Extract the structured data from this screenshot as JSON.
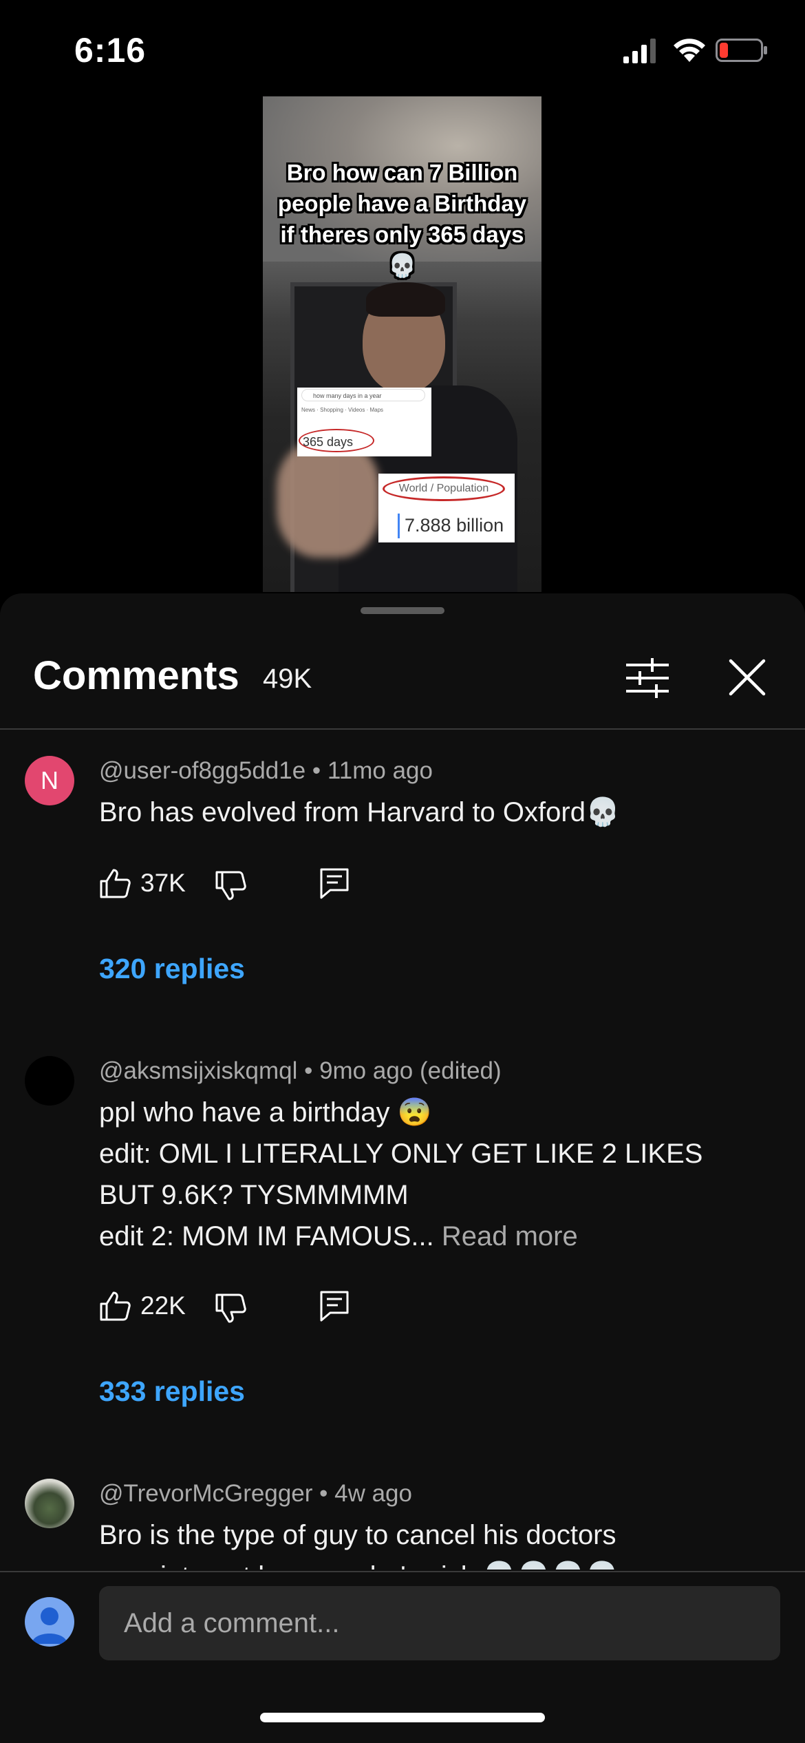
{
  "status_bar": {
    "time": "6:16",
    "icons": [
      "cellular-signal-icon",
      "wifi-icon",
      "battery-low-icon"
    ],
    "battery_color": "#ff3b30"
  },
  "video": {
    "caption": "Bro how can 7 Billion people have a Birthday if theres only 365 days 💀",
    "search_card": {
      "query": "how many days in a year",
      "tabs": "News · Shopping · Videos · Maps",
      "answer": "365 days"
    },
    "population_card": {
      "label": "World / Population",
      "value": "7.888 billion"
    }
  },
  "comments_panel": {
    "title": "Comments",
    "count": "49K",
    "icons": [
      "sort-filter-icon",
      "close-icon"
    ]
  },
  "comments": [
    {
      "avatar_letter": "N",
      "avatar_color": "#e2476f",
      "author": "@user-of8gg5dd1e",
      "time": "11mo ago",
      "text": "Bro has evolved from Harvard to Oxford💀",
      "likes": "37K",
      "replies": "320 replies"
    },
    {
      "avatar_color": "#000000",
      "author": "@aksmsijxiskqmql",
      "time": "9mo ago (edited)",
      "lines": [
        "ppl who have a birthday 😨",
        "edit: OML I LITERALLY ONLY GET LIKE 2 LIKES BUT 9.6K? TYSMMMMM",
        "edit 2: MOM IM FAMOUS..."
      ],
      "read_more": "Read more",
      "likes": "22K",
      "replies": "333 replies"
    },
    {
      "author": "@TrevorMcGregger",
      "time": "4w ago",
      "text": "Bro is the type of guy to cancel his doctors appointment because he's sick 💀💀💀💀"
    }
  ],
  "composer": {
    "placeholder": "Add a comment..."
  },
  "colors": {
    "accent_link": "#3ea6ff",
    "sheet_bg": "#0f0f0f",
    "input_bg": "#272727"
  }
}
